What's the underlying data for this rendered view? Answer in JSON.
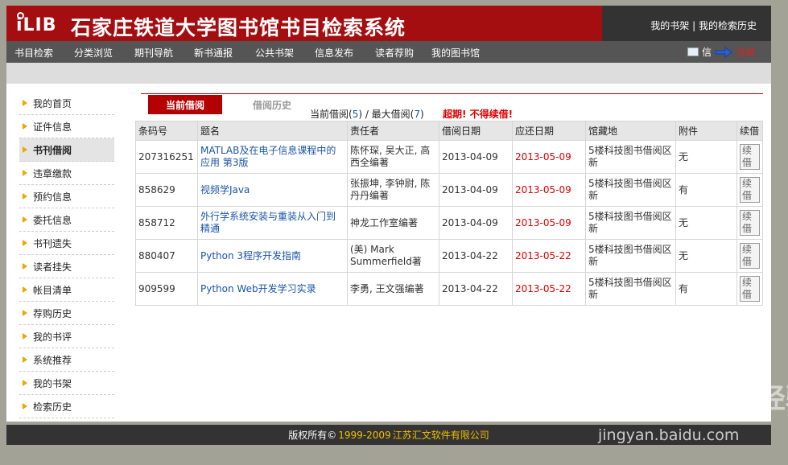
{
  "header": {
    "logo_text": "iLIB",
    "title": "石家庄铁道大学图书馆书目检索系统",
    "link_bookshelf": "我的书架",
    "link_separator": "|",
    "link_search_history": "我的检索历史"
  },
  "nav": {
    "items": [
      "书目检索",
      "分类浏览",
      "期刊导航",
      "新书通报",
      "公共书架",
      "信息发布",
      "读者荐购",
      "我的图书馆"
    ],
    "user_label": "信",
    "logout_label": "注销"
  },
  "sidebar": {
    "items": [
      "我的首页",
      "证件信息",
      "书刊借阅",
      "违章缴款",
      "预约信息",
      "委托信息",
      "书刊遗失",
      "读者挂失",
      "帐目清单",
      "荐购历史",
      "我的书评",
      "系统推荐",
      "我的书架",
      "检索历史"
    ],
    "active_index": 2
  },
  "tabs": {
    "current": "当前借阅",
    "history": "借阅历史"
  },
  "borrow_info": {
    "current_label": "当前借阅(",
    "current_count": "5",
    "separator": ") / 最大借阅(",
    "max_count": "7",
    "close": ")",
    "warning": "超期! 不得续借!"
  },
  "table": {
    "headers": [
      "条码号",
      "题名",
      "责任者",
      "借阅日期",
      "应还日期",
      "馆藏地",
      "附件",
      "续借"
    ],
    "rows": [
      [
        "207316251",
        "MATLAB及在电子信息课程中的应用 第3版",
        "陈怀琛, 吴大正, 高西全编著",
        "2013-04-09",
        "2013-05-09",
        "5楼科技图书借阅区新",
        "无",
        "续借"
      ],
      [
        "858629",
        "视频学Java",
        "张振坤, 李钟尉, 陈丹丹编著",
        "2013-04-09",
        "2013-05-09",
        "5楼科技图书借阅区新",
        "有",
        "续借"
      ],
      [
        "858712",
        "外行学系统安装与重装从入门到精通",
        "神龙工作室编著",
        "2013-04-09",
        "2013-05-09",
        "5楼科技图书借阅区新",
        "无",
        "续借"
      ],
      [
        "880407",
        "Python 3程序开发指南",
        "(美) Mark Summerfield著",
        "2013-04-22",
        "2013-05-22",
        "5楼科技图书借阅区新",
        "无",
        "续借"
      ],
      [
        "909599",
        "Python Web开发学习实录",
        "李勇, 王文强编著",
        "2013-04-22",
        "2013-05-22",
        "5楼科技图书借阅区新",
        "有",
        "续借"
      ]
    ]
  },
  "footer": {
    "prefix": "版权所有©",
    "years": "1999-2009",
    "company": "江苏汇文软件有限公司"
  },
  "watermark": {
    "brand": "Bai du 经验",
    "url": "jingyan.baidu.com"
  },
  "colors": {
    "header_red": "#a50e10",
    "header_dark": "#333333",
    "nav_gray": "#555555",
    "accent_red": "#d00000",
    "link_blue": "#1a54a6",
    "bullet_orange": "#f2a400"
  }
}
